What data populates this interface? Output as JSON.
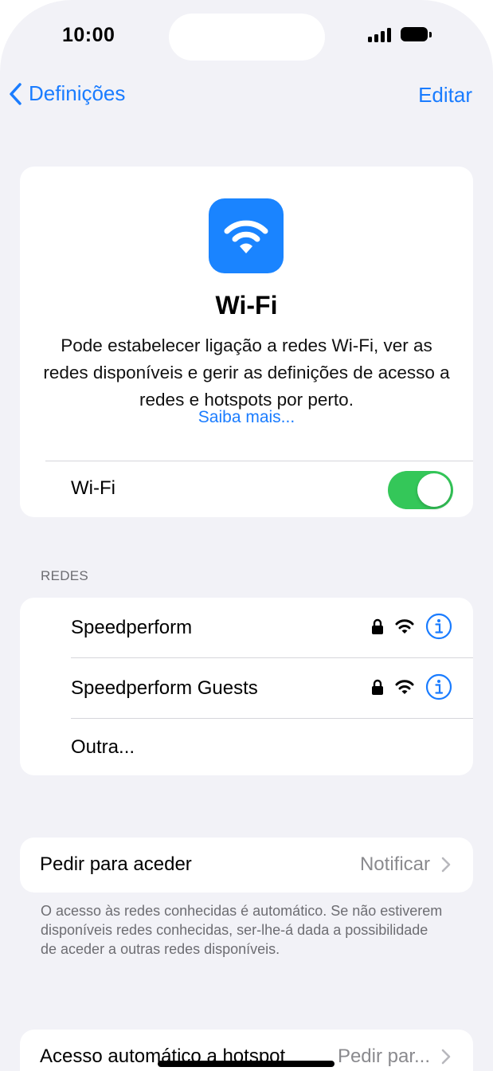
{
  "status_bar": {
    "time": "10:00"
  },
  "nav": {
    "back_label": "Definições",
    "edit_label": "Editar"
  },
  "hero": {
    "title": "Wi-Fi",
    "description": "Pode estabelecer ligação a redes Wi-Fi, ver as redes disponíveis e gerir as definições de acesso a redes e hotspots por perto.",
    "link": "Saiba mais...",
    "toggle_label": "Wi-Fi",
    "toggle_on": true
  },
  "networks": {
    "header": "REDES",
    "items": [
      {
        "name": "Speedperform",
        "locked": true
      },
      {
        "name": "Speedperform Guests",
        "locked": true
      },
      {
        "name": "Outra..."
      }
    ]
  },
  "ask_to_join": {
    "label": "Pedir para aceder",
    "value": "Notificar",
    "footnote": "O acesso às redes conhecidas é automático. Se não estiverem disponíveis redes conhecidas, ser-lhe-á dada a possibilidade de aceder a outras redes disponíveis."
  },
  "hotspot": {
    "label": "Acesso automático a hotspot",
    "value": "Pedir par..."
  },
  "colors": {
    "accent": "#1a7cff",
    "toggle_on": "#34c759",
    "wifi_tile": "#1a84ff"
  }
}
